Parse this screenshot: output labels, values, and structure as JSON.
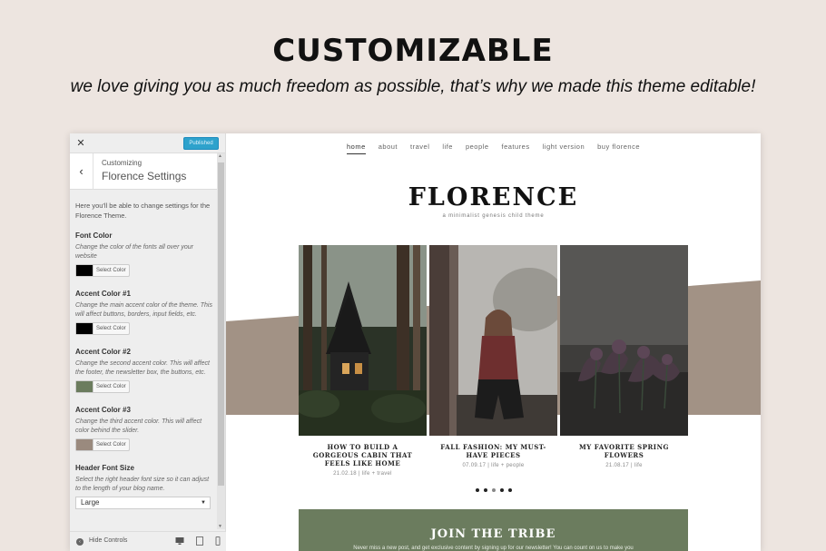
{
  "banner": {
    "heading": "CUSTOMIZABLE",
    "subheading": "we love giving you as much freedom as possible, that’s why we made this theme editable!"
  },
  "customizer": {
    "close_glyph": "✕",
    "publish_label": "Published",
    "back_glyph": "‹",
    "breadcrumb": "Customizing",
    "title": "Florence Settings",
    "intro": "Here you'll be able to change settings for the Florence Theme.",
    "settings": [
      {
        "title": "Font Color",
        "description": "Change the color of the fonts all over your website",
        "color": "#000000",
        "button": "Select Color"
      },
      {
        "title": "Accent Color #1",
        "description": "Change the main accent color of the theme. This will affect buttons, borders, input fields, etc.",
        "color": "#000000",
        "button": "Select Color"
      },
      {
        "title": "Accent Color #2",
        "description": "Change the second accent color. This will affect the footer, the newsletter box, the buttons, etc.",
        "color": "#6b7c5e",
        "button": "Select Color"
      },
      {
        "title": "Accent Color #3",
        "description": "Change the third accent color. This will affect color behind the slider.",
        "color": "#9a8a7e",
        "button": "Select Color"
      }
    ],
    "font_size": {
      "title": "Header Font Size",
      "description": "Select the right header font size so it can adjust to the length of your blog name.",
      "selected": "Large"
    },
    "footer": {
      "hide_label": "Hide Controls",
      "devices": [
        "desktop-icon",
        "tablet-icon",
        "mobile-icon"
      ]
    }
  },
  "preview": {
    "nav": [
      "home",
      "about",
      "travel",
      "life",
      "people",
      "features",
      "light version",
      "buy florence"
    ],
    "active_nav": "home",
    "logo": "FLORENCE",
    "tagline": "a minimalist genesis child theme",
    "band_color": "#a29285",
    "posts": [
      {
        "title": "HOW TO BUILD A GORGEOUS CABIN THAT FEELS LIKE HOME",
        "date": "21.02.18",
        "sep": "|",
        "cats": "life + travel"
      },
      {
        "title": "FALL FASHION: MY MUST-HAVE PIECES",
        "date": "07.09.17",
        "sep": "|",
        "cats": "life + people"
      },
      {
        "title": "MY FAVORITE SPRING FLOWERS",
        "date": "21.08.17",
        "sep": "|",
        "cats": "life"
      }
    ],
    "slider_dots": 5,
    "active_dot": 1,
    "newsletter": {
      "title": "JOIN THE TRIBE",
      "text": "Never miss a new post, and get exclusive content by signing up for our newsletter! You can count on us to make you",
      "color": "#6b7c5e"
    }
  }
}
